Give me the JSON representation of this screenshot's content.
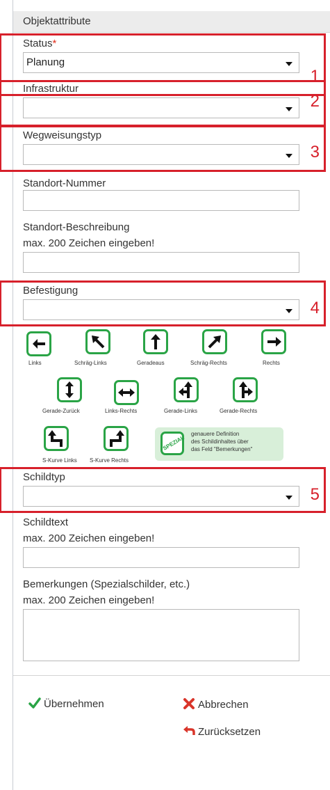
{
  "panel": {
    "title": "Objektattribute"
  },
  "fields": {
    "status": {
      "label": "Status",
      "required_mark": "*",
      "value": "Planung",
      "marker": "1"
    },
    "infrastruktur": {
      "label": "Infrastruktur",
      "value": "",
      "marker": "2"
    },
    "wegweisungstyp": {
      "label": "Wegweisungstyp",
      "value": "",
      "marker": "3"
    },
    "standort_nummer": {
      "label": "Standort-Nummer",
      "value": ""
    },
    "standort_beschreibung": {
      "label": "Standort-Beschreibung",
      "hint": "max. 200 Zeichen eingeben!",
      "value": ""
    },
    "befestigung": {
      "label": "Befestigung",
      "value": "",
      "marker": "4"
    },
    "schildtyp": {
      "label": "Schildtyp",
      "value": "",
      "marker": "5"
    },
    "schildtext": {
      "label": "Schildtext",
      "hint": "max. 200 Zeichen eingeben!",
      "value": ""
    },
    "bemerkungen": {
      "label": "Bemerkungen (Spezialschilder, etc.)",
      "hint": "max. 200 Zeichen eingeben!",
      "value": ""
    }
  },
  "signs": {
    "links": "Links",
    "schraeg_links": "Schräg-Links",
    "geradeaus": "Geradeaus",
    "schraeg_rechts": "Schräg-Rechts",
    "rechts": "Rechts",
    "gerade_zurueck": "Gerade-Zurück",
    "links_rechts": "Links-Rechts",
    "gerade_links": "Gerade-Links",
    "gerade_rechts": "Gerade-Rechts",
    "s_kurve_links": "S-Kurve Links",
    "s_kurve_rechts": "S-Kurve Rechts",
    "spezial_badge": "SPEZIAL",
    "spezial_line1": "genauere Definition",
    "spezial_line2": "des Schildinhaltes über",
    "spezial_line3": "das Feld \"Bemerkungen\""
  },
  "actions": {
    "apply": "Übernehmen",
    "cancel": "Abbrechen",
    "reset": "Zurücksetzen"
  },
  "colors": {
    "highlight": "#d7202b",
    "sign_green": "#2aa446",
    "apply_green": "#2aa446",
    "cancel_red": "#d9352a"
  }
}
